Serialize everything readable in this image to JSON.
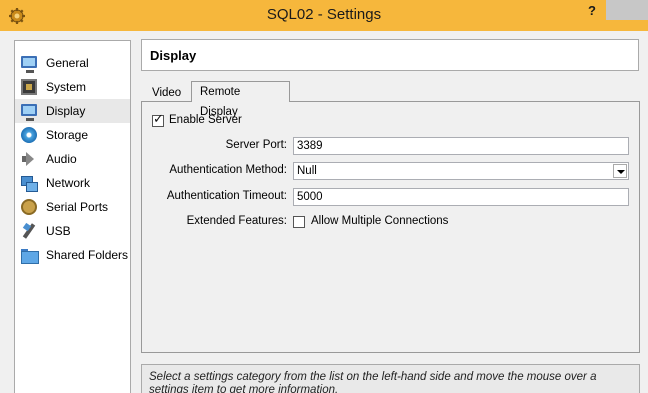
{
  "window": {
    "title": "SQL02 - Settings",
    "help_label": "?",
    "icon": "gear-icon"
  },
  "colors": {
    "titlebar": "#f6b73c",
    "selected_item": "#e8e8e8"
  },
  "sidebar": {
    "items": [
      {
        "label": "General",
        "icon": "monitor-icon",
        "selected": false
      },
      {
        "label": "System",
        "icon": "chip-icon",
        "selected": false
      },
      {
        "label": "Display",
        "icon": "monitor-icon",
        "selected": true
      },
      {
        "label": "Storage",
        "icon": "disk-icon",
        "selected": false
      },
      {
        "label": "Audio",
        "icon": "speaker-icon",
        "selected": false
      },
      {
        "label": "Network",
        "icon": "network-icon",
        "selected": false
      },
      {
        "label": "Serial Ports",
        "icon": "serial-port-icon",
        "selected": false
      },
      {
        "label": "USB",
        "icon": "usb-icon",
        "selected": false
      },
      {
        "label": "Shared Folders",
        "icon": "folder-icon",
        "selected": false
      }
    ]
  },
  "page": {
    "title": "Display"
  },
  "tabs": [
    {
      "label": "Video",
      "active": false
    },
    {
      "label": "Remote Display",
      "active": true
    }
  ],
  "remote_display": {
    "enable_server": {
      "label": "Enable Server",
      "checked": true
    },
    "server_port": {
      "label": "Server Port:",
      "value": "3389"
    },
    "auth_method": {
      "label": "Authentication Method:",
      "value": "Null"
    },
    "auth_timeout": {
      "label": "Authentication Timeout:",
      "value": "5000"
    },
    "extended": {
      "label": "Extended Features:",
      "option_label": "Allow Multiple Connections",
      "checked": false
    }
  },
  "description": {
    "text": "Select a settings category from the list on the left-hand side and move the mouse over a settings item to get more information."
  }
}
